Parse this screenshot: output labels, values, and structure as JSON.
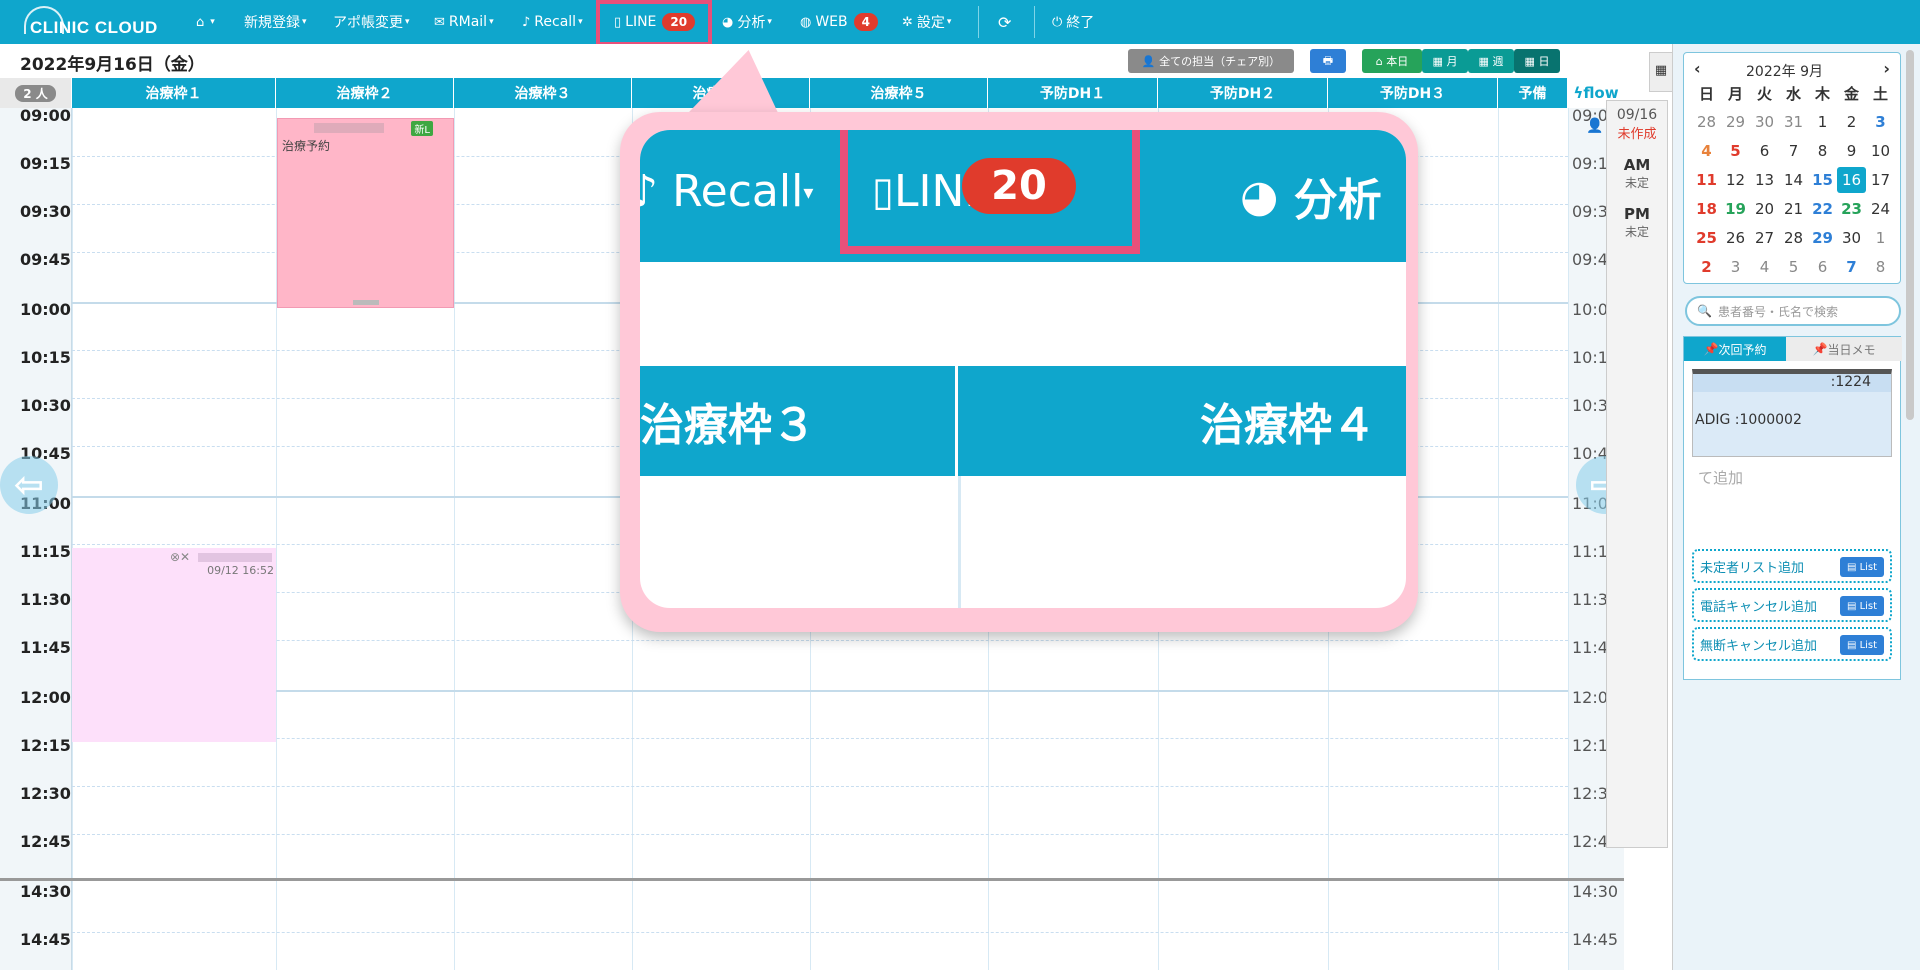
{
  "app": {
    "logo_text": "CLINIC CLOUD"
  },
  "nav": {
    "home_label": "▾",
    "new_reg": "新規登録",
    "appo_change": "アポ帳変更",
    "rmail": "RMail",
    "recall": "Recall",
    "line": "LINE",
    "line_badge": "20",
    "analysis": "分析",
    "web": "WEB",
    "web_badge": "4",
    "settings": "設定",
    "exit": "終了"
  },
  "datebar": {
    "date": "2022年9月16日（金）",
    "staff_filter": "全ての担当（チェア別）",
    "today": "本日",
    "month": "月",
    "week": "週",
    "day": "日"
  },
  "columns": {
    "count": "2 人",
    "headers": [
      "治療枠１",
      "治療枠２",
      "治療枠３",
      "治療枠４",
      "治療枠５",
      "予防DH１",
      "予防DH２",
      "予防DH３",
      "予備"
    ],
    "flow": "flow"
  },
  "times": [
    "09:00",
    "09:15",
    "09:30",
    "09:45",
    "10:00",
    "10:15",
    "10:30",
    "10:45",
    "11:00",
    "11:15",
    "11:30",
    "11:45",
    "12:00",
    "12:15",
    "12:30",
    "12:45",
    "14:30",
    "14:45"
  ],
  "appointments": {
    "a1_label": "治療予約",
    "a1_tag": "新L",
    "a2_time": "09/12 16:52"
  },
  "ampm": {
    "date": "09/16",
    "status": "未作成",
    "am": "AM",
    "am_val": "未定",
    "pm": "PM",
    "pm_val": "未定"
  },
  "calendar": {
    "title": "2022年 9月",
    "weekdays": [
      "日",
      "月",
      "火",
      "水",
      "木",
      "金",
      "土"
    ],
    "weeks": [
      [
        "28",
        "29",
        "30",
        "31",
        "1",
        "2",
        "3"
      ],
      [
        "4",
        "5",
        "6",
        "7",
        "8",
        "9",
        "10"
      ],
      [
        "11",
        "12",
        "13",
        "14",
        "15",
        "16",
        "17"
      ],
      [
        "18",
        "19",
        "20",
        "21",
        "22",
        "23",
        "24"
      ],
      [
        "25",
        "26",
        "27",
        "28",
        "29",
        "30",
        "1"
      ],
      [
        "2",
        "3",
        "4",
        "5",
        "6",
        "7",
        "8"
      ]
    ]
  },
  "search": {
    "placeholder": "患者番号・氏名で検索"
  },
  "panel": {
    "tab_next": "次回予約",
    "tab_memo": "当日メモ",
    "card_line1": ":1224",
    "card_line2": "ADIG :1000002",
    "add_hint": "て追加",
    "list_btn": "List",
    "add1": "未定者リスト追加",
    "add2": "電話キャンセル追加",
    "add3": "無断キャンセル追加"
  },
  "zoom": {
    "recall": "Recall",
    "line": "LINE",
    "badge": "20",
    "analysis": "分析",
    "col3": "治療枠３",
    "col4": "治療枠４"
  },
  "colors": {
    "topbar": "#0fa6cc",
    "highlight": "#e8507a",
    "badge": "#e03b2c",
    "appt_pink": "#ffb6c8",
    "appt_lavender": "#fde0fa",
    "callout": "#ffc8d7"
  }
}
